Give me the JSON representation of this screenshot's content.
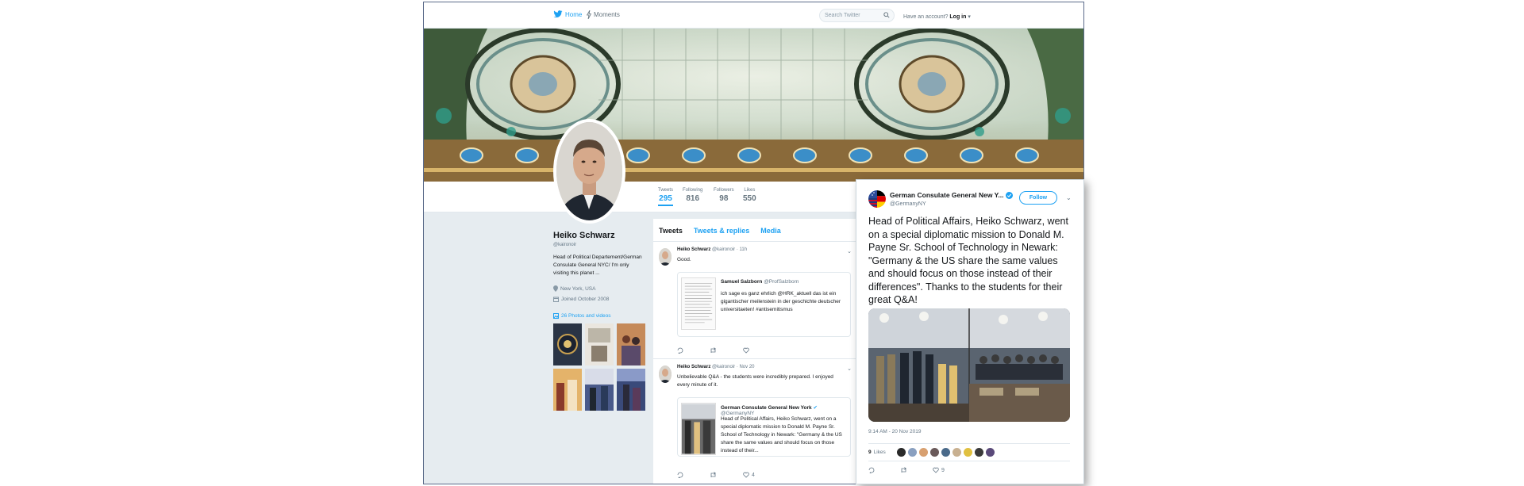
{
  "nav": {
    "home": "Home",
    "moments": "Moments",
    "search_placeholder": "Search Twitter",
    "have_account": "Have an account?",
    "login": "Log in"
  },
  "stats": [
    {
      "label": "Tweets",
      "value": "295"
    },
    {
      "label": "Following",
      "value": "816"
    },
    {
      "label": "Followers",
      "value": "98"
    },
    {
      "label": "Likes",
      "value": "550"
    }
  ],
  "profile": {
    "name": "Heiko Schwarz",
    "handle": "@kaironoir",
    "bio": "Head of Political Departement/German Consulate General NYC/ I'm only visiting this planet ...",
    "location": "New York, USA",
    "joined": "Joined October 2008",
    "photos": "26 Photos and videos"
  },
  "tabs": [
    "Tweets",
    "Tweets & replies",
    "Media"
  ],
  "tweets": [
    {
      "name": "Heiko Schwarz",
      "handle": "@kaironoir",
      "time": "· 11h",
      "text": "Good.",
      "quote_name": "Samuel Salzborn",
      "quote_handle": "@ProfSalzborn",
      "quote_text": "ich sage es ganz ehrlich @HRK_aktuell das ist ein gigantischer meilenstein in der geschichte deutscher universitaeten! #antisemitismus",
      "reply": "",
      "retweet": "",
      "like": ""
    },
    {
      "name": "Heiko Schwarz",
      "handle": "@kaironoir",
      "time": "· Nov 20",
      "text": "Unbelievable Q&A - the students were incredibly prepared. I enjoyed every minute of it.",
      "quote_name": "German Consulate General New York",
      "quote_handle": "@GermanyNY",
      "quote_text": "Head of Political Affairs, Heiko Schwarz, went on a special diplomatic mission to Donald M. Payne Sr. School of Technology in Newark: \"Germany & the US share the same values and should focus on those instead of their...",
      "reply": "",
      "retweet": "",
      "like": "4"
    }
  ],
  "card": {
    "name": "German Consulate General New Y...",
    "handle": "@GermanyNY",
    "follow": "Follow",
    "text": "Head of Political Affairs, Heiko Schwarz, went on a special diplomatic mission to Donald M. Payne Sr. School of Technology in Newark: \"Germany & the US share the same values and should focus on those instead of their differences\". Thanks to the students for their great Q&A!",
    "time": "9:14 AM - 20 Nov 2019",
    "likes_count": "9",
    "likes_label": "Likes",
    "like_action_count": "9"
  },
  "colors": {
    "accent": "#1da1f2",
    "background": "#e6ecf0"
  }
}
